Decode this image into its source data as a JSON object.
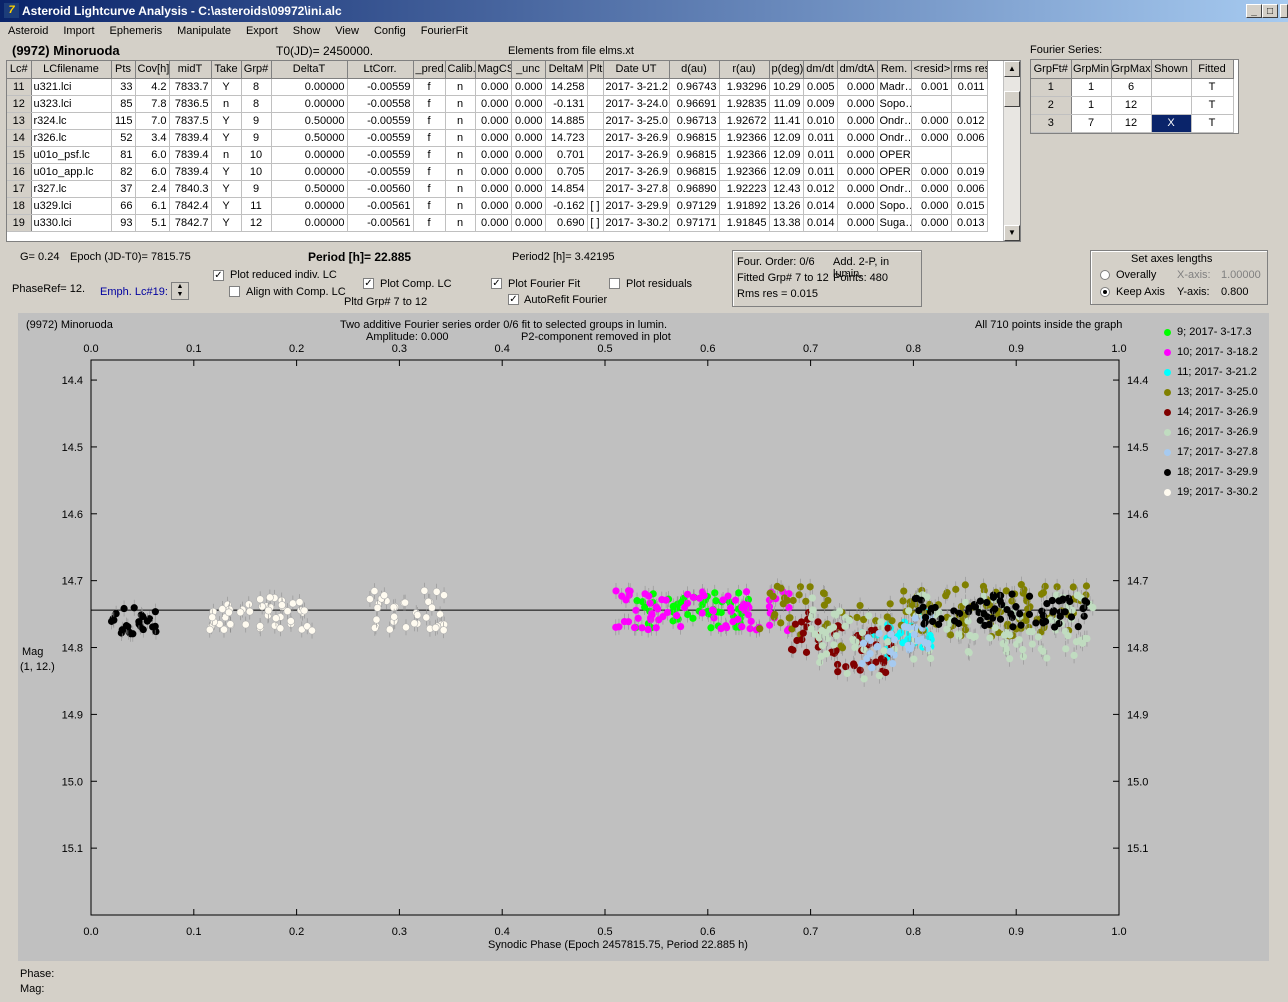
{
  "window": {
    "title": "Asteroid Lightcurve Analysis - C:\\asteroids\\09972\\ini.alc",
    "min_label": "_",
    "max_label": "□",
    "close_label": "X"
  },
  "menu": [
    "Asteroid",
    "Import",
    "Ephemeris",
    "Manipulate",
    "Export",
    "Show",
    "View",
    "Config",
    "FourierFit"
  ],
  "header": {
    "asteroid": "(9972) Minoruoda",
    "t0": "T0(JD)= 2450000.",
    "elements": "Elements from file elms.xt",
    "fourier_series": "Fourier Series:"
  },
  "table": {
    "columns": [
      "Lc#",
      "LCfilename",
      "Pts",
      "Cov[h]",
      "midT",
      "Take",
      "Grp#",
      "DeltaT",
      "LtCorr.",
      "_pred.",
      "Calib.",
      "MagCS",
      "_unc",
      "DeltaM",
      "Plt",
      "Date UT",
      "d(au)",
      "r(au)",
      "p(deg)",
      "dm/dt",
      "dm/dtA",
      "Rem.",
      "<resid>",
      "rms res"
    ],
    "rows": [
      [
        "11",
        "u321.lci",
        "33",
        "4.2",
        "7833.7",
        "Y",
        "8",
        "0.00000",
        "-0.00559",
        "f",
        "n",
        "0.000",
        "0.000",
        "14.258",
        "",
        "2017- 3-21.2",
        "0.96743",
        "1.93296",
        "10.29",
        "0.005",
        "0.000",
        "Madr…",
        "0.001",
        "0.011"
      ],
      [
        "12",
        "u323.lci",
        "85",
        "7.8",
        "7836.5",
        "n",
        "8",
        "0.00000",
        "-0.00558",
        "f",
        "n",
        "0.000",
        "0.000",
        "-0.131",
        "",
        "2017- 3-24.0",
        "0.96691",
        "1.92835",
        "11.09",
        "0.009",
        "0.000",
        "Sopo…",
        "",
        ""
      ],
      [
        "13",
        "r324.lc",
        "115",
        "7.0",
        "7837.5",
        "Y",
        "9",
        "0.50000",
        "-0.00559",
        "f",
        "n",
        "0.000",
        "0.000",
        "14.885",
        "",
        "2017- 3-25.0",
        "0.96713",
        "1.92672",
        "11.41",
        "0.010",
        "0.000",
        "Ondr…",
        "0.000",
        "0.012"
      ],
      [
        "14",
        "r326.lc",
        "52",
        "3.4",
        "7839.4",
        "Y",
        "9",
        "0.50000",
        "-0.00559",
        "f",
        "n",
        "0.000",
        "0.000",
        "14.723",
        "",
        "2017- 3-26.9",
        "0.96815",
        "1.92366",
        "12.09",
        "0.011",
        "0.000",
        "Ondr…",
        "0.000",
        "0.006"
      ],
      [
        "15",
        "u01o_psf.lc",
        "81",
        "6.0",
        "7839.4",
        "n",
        "10",
        "0.00000",
        "-0.00559",
        "f",
        "n",
        "0.000",
        "0.000",
        "0.701",
        "",
        "2017- 3-26.9",
        "0.96815",
        "1.92366",
        "12.09",
        "0.011",
        "0.000",
        "OPER.",
        "",
        ""
      ],
      [
        "16",
        "u01o_app.lc",
        "82",
        "6.0",
        "7839.4",
        "Y",
        "10",
        "0.00000",
        "-0.00559",
        "f",
        "n",
        "0.000",
        "0.000",
        "0.705",
        "",
        "2017- 3-26.9",
        "0.96815",
        "1.92366",
        "12.09",
        "0.011",
        "0.000",
        "OPER.",
        "0.000",
        "0.019"
      ],
      [
        "17",
        "r327.lc",
        "37",
        "2.4",
        "7840.3",
        "Y",
        "9",
        "0.50000",
        "-0.00560",
        "f",
        "n",
        "0.000",
        "0.000",
        "14.854",
        "",
        "2017- 3-27.8",
        "0.96890",
        "1.92223",
        "12.43",
        "0.012",
        "0.000",
        "Ondr…",
        "0.000",
        "0.006"
      ],
      [
        "18",
        "u329.lci",
        "66",
        "6.1",
        "7842.4",
        "Y",
        "11",
        "0.00000",
        "-0.00561",
        "f",
        "n",
        "0.000",
        "0.000",
        "-0.162",
        "[ ]",
        "2017- 3-29.9",
        "0.97129",
        "1.91892",
        "13.26",
        "0.014",
        "0.000",
        "Sopo…",
        "0.000",
        "0.015"
      ],
      [
        "19",
        "u330.lci",
        "93",
        "5.1",
        "7842.7",
        "Y",
        "12",
        "0.00000",
        "-0.00561",
        "f",
        "n",
        "0.000",
        "0.000",
        "0.690",
        "[ ]",
        "2017- 3-30.2",
        "0.97171",
        "1.91845",
        "13.38",
        "0.014",
        "0.000",
        "Suga…",
        "0.000",
        "0.013"
      ]
    ]
  },
  "fourier_table": {
    "columns": [
      "GrpFt#",
      "GrpMin",
      "GrpMax",
      "Shown",
      "Fitted"
    ],
    "rows": [
      [
        "1",
        "1",
        "6",
        "",
        "T"
      ],
      [
        "2",
        "1",
        "12",
        "",
        "T"
      ],
      [
        "3",
        "7",
        "12",
        "X",
        "T"
      ]
    ]
  },
  "controls": {
    "g": "G= 0.24",
    "epoch": "Epoch (JD-T0)= 7815.75",
    "period": "Period [h]= 22.885",
    "period2": "Period2 [h]= 3.42195",
    "phaseref": "PhaseRef= 12.",
    "emph": "Emph. Lc#19:",
    "plot_reduced": "Plot reduced indiv. LC",
    "align": "Align with Comp. LC",
    "plot_comp": "Plot Comp. LC",
    "pltd_grp": "Pltd Grp#  7   to   12",
    "plot_fourier": "Plot Fourier Fit",
    "autorefit": "AutoRefit Fourier",
    "plot_residuals": "Plot residuals",
    "four_order": "Four. Order:  0/6",
    "add2p": "Add. 2-P, in lumin.",
    "fitted_grp": "Fitted Grp# 7 to 12",
    "points": "Points: 480",
    "rms": "Rms res     = 0.015",
    "axes_title": "Set axes lengths",
    "overally": "Overally",
    "keep_axis": "Keep Axis",
    "xaxis_label": "X-axis:",
    "xaxis_val": "1.00000",
    "yaxis_label": "Y-axis:",
    "yaxis_val": "0.800"
  },
  "plot": {
    "name": "(9972) Minoruoda",
    "title1": "Two additive Fourier series order 0/6 fit to selected groups in lumin.",
    "title2": "Amplitude: 0.000",
    "title3": "P2-component removed in plot",
    "points_note": "All 710 points inside the graph",
    "ylabel1": "Mag",
    "ylabel2": "(1, 12.)",
    "xlabel": "Synodic Phase (Epoch 2457815.75, Period 22.885 h)"
  },
  "chart_data": {
    "type": "scatter",
    "xlim": [
      0.0,
      1.0
    ],
    "ylim": [
      15.2,
      14.37
    ],
    "x_ticks": [
      "0.0",
      "0.1",
      "0.2",
      "0.3",
      "0.4",
      "0.5",
      "0.6",
      "0.7",
      "0.8",
      "0.9",
      "1.0"
    ],
    "y_ticks": [
      "14.4",
      "14.5",
      "14.6",
      "14.7",
      "14.8",
      "14.9",
      "15.0",
      "15.1"
    ],
    "fit_line_y": 14.744,
    "series": [
      {
        "name": "9; 2017- 3-17.3",
        "color": "#00ff00",
        "ranges": [
          [
            0.53,
            0.64,
            14.745,
            0.03
          ]
        ]
      },
      {
        "name": "10; 2017- 3-18.2",
        "color": "#ff00ff",
        "ranges": [
          [
            0.51,
            0.68,
            14.745,
            0.03
          ]
        ]
      },
      {
        "name": "11; 2017- 3-21.2",
        "color": "#00ffff",
        "ranges": [
          [
            0.75,
            0.82,
            14.77,
            0.03
          ]
        ]
      },
      {
        "name": "13; 2017- 3-25.0",
        "color": "#808000",
        "ranges": [
          [
            0.65,
            0.97,
            14.745,
            0.04
          ]
        ]
      },
      {
        "name": "14; 2017- 3-26.9",
        "color": "#800000",
        "ranges": [
          [
            0.68,
            0.78,
            14.78,
            0.035
          ]
        ]
      },
      {
        "name": "16; 2017- 3-26.9",
        "color": "#c0dcc0",
        "ranges": [
          [
            0.7,
            0.98,
            14.77,
            0.05
          ]
        ]
      },
      {
        "name": "17; 2017- 3-27.8",
        "color": "#a6caf0",
        "ranges": [
          [
            0.75,
            0.82,
            14.78,
            0.03
          ]
        ]
      },
      {
        "name": "18; 2017- 3-29.9",
        "color": "#000000",
        "ranges": [
          [
            0.02,
            0.065,
            14.76,
            0.02
          ],
          [
            0.8,
            0.97,
            14.745,
            0.025
          ]
        ]
      },
      {
        "name": "19; 2017- 3-30.2",
        "color": "#fffbf0",
        "ranges": [
          [
            0.115,
            0.215,
            14.75,
            0.025
          ],
          [
            0.27,
            0.345,
            14.745,
            0.03
          ]
        ]
      }
    ]
  },
  "status": {
    "phase": "Phase:",
    "mag": "Mag:"
  }
}
